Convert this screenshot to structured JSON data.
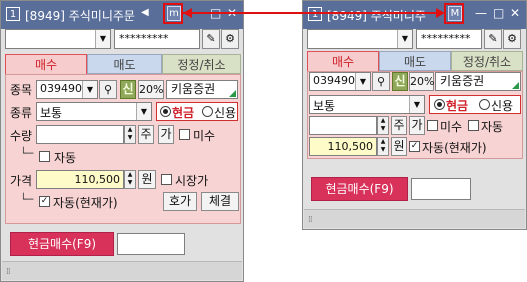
{
  "left": {
    "window_num": "1",
    "title": "[8949] 주식미니주문",
    "mode_icon": "m",
    "account_mask": "*********",
    "tabs": [
      "매수",
      "매도",
      "정정/취소"
    ],
    "code_label": "종목",
    "code": "039490",
    "credit_btn": "신",
    "margin_rate": "20%",
    "stock_name": "키움증권",
    "type_label": "종류",
    "order_type": "보통",
    "radio_cash": "현금",
    "radio_credit": "신용",
    "qty_label": "수량",
    "qty_value": "",
    "btn_ju": "주",
    "btn_ga": "가",
    "chk_unfilled": "미수",
    "chk_auto": "자동",
    "price_label": "가격",
    "price_value": "110,500",
    "won": "원",
    "chk_market": "시장가",
    "chk_auto_current": "자동(현재가)",
    "btn_quote": "호가",
    "btn_fill": "체결",
    "order_button": "현금매수(F9)"
  },
  "right": {
    "window_num": "1",
    "title": "[8949] 주식미니주",
    "mode_icon": "M",
    "account_mask": "*********",
    "tabs": [
      "매수",
      "매도",
      "정정/취소"
    ],
    "code": "039490",
    "credit_btn": "신",
    "margin_rate": "20%",
    "stock_name": "키움증권",
    "order_type": "보통",
    "radio_cash": "현금",
    "radio_credit": "신용",
    "btn_ju": "주",
    "btn_ga": "가",
    "chk_unfilled": "미수",
    "chk_auto": "자동",
    "price_value": "110,500",
    "won": "원",
    "chk_auto_current": "자동(현재가)",
    "order_button": "현금매수(F9)"
  },
  "colors": {
    "titlebar": "#5a6e9a",
    "highlight": "#e01010",
    "buy_panel": "#f7d3d3",
    "order_button": "#d8315a",
    "price_field": "#fffbc8"
  }
}
